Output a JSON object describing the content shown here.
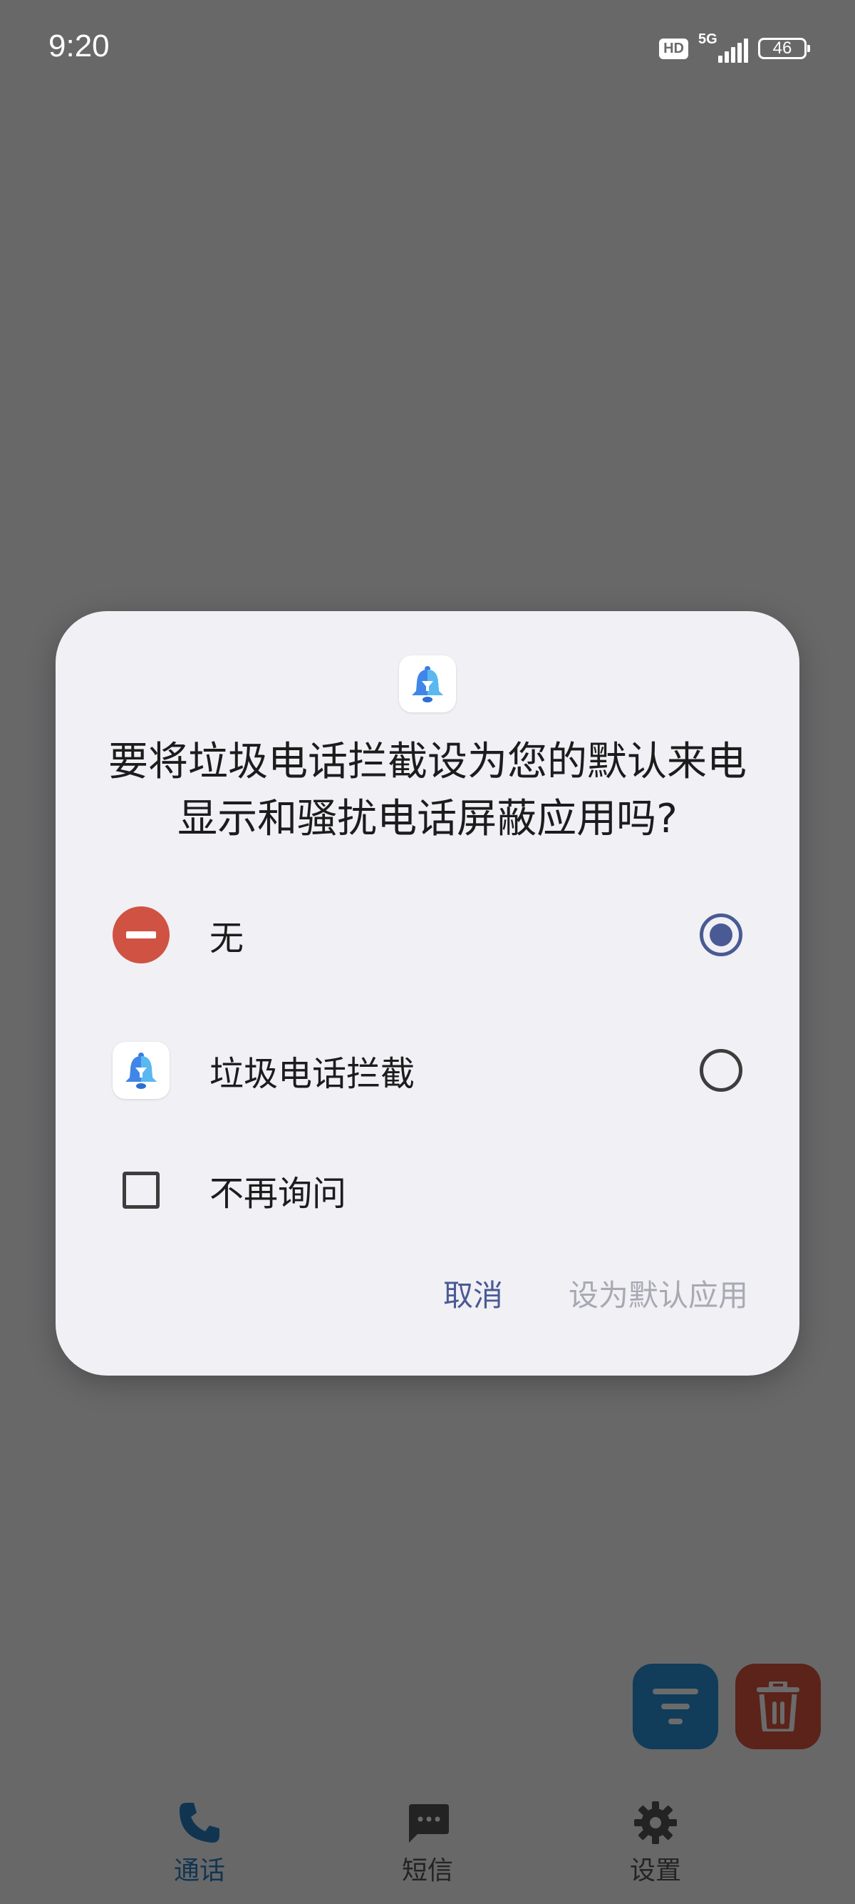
{
  "status_bar": {
    "time": "9:20",
    "hd": "HD",
    "network": "5G",
    "battery": "46"
  },
  "dialog": {
    "title": "要将垃圾电话拦截设为您的默认来电显示和骚扰电话屏蔽应用吗?",
    "options": [
      {
        "label": "无",
        "icon": "no-entry-icon",
        "selected": true
      },
      {
        "label": "垃圾电话拦截",
        "icon": "bell-app-icon",
        "selected": false
      }
    ],
    "dont_ask_label": "不再询问",
    "cancel_label": "取消",
    "set_default_label": "设为默认应用"
  },
  "bottom_nav": {
    "items": [
      {
        "label": "通话",
        "icon": "phone-icon",
        "active": true
      },
      {
        "label": "短信",
        "icon": "message-icon",
        "active": false
      },
      {
        "label": "设置",
        "icon": "gear-icon",
        "active": false
      }
    ]
  },
  "fabs": {
    "filter_icon": "filter-icon",
    "delete_icon": "trash-icon"
  },
  "colors": {
    "accent": "#4a5a94",
    "none_red": "#d05243",
    "fab_blue": "#2a8fd6",
    "fab_red": "#d9533f",
    "disabled_text": "#a9a9b4"
  }
}
